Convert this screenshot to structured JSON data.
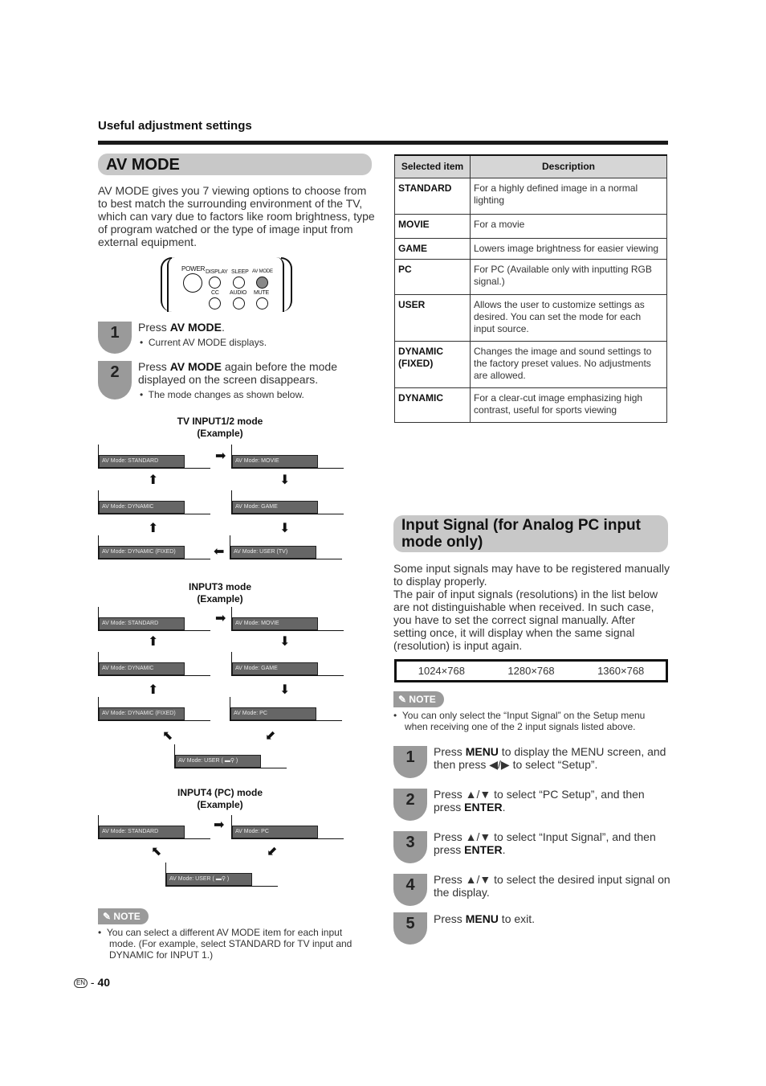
{
  "header": {
    "section_title": "Useful adjustment settings"
  },
  "av_mode": {
    "heading": "AV MODE",
    "intro": "AV MODE gives you 7 viewing options to choose from to best match the surrounding environment of the TV, which can vary due to factors like room brightness, type of program watched or the type of image input from external equipment.",
    "remote": {
      "buttons": [
        "POWER",
        "DISPLAY",
        "SLEEP",
        "AV MODE",
        "CC",
        "AUDIO",
        "MUTE"
      ],
      "highlighted": "AV MODE"
    },
    "steps": [
      {
        "num": "1",
        "pre": "Press ",
        "bold": "AV MODE",
        "post": ".",
        "sub": "Current AV MODE displays."
      },
      {
        "num": "2",
        "pre": "Press ",
        "bold": "AV MODE",
        "post": " again before the mode displayed on the screen disappears.",
        "sub": "The mode changes as shown below."
      }
    ],
    "diagrams": [
      {
        "title_line1": "TV INPUT1/2 mode",
        "title_line2": "(Example)",
        "screens": [
          "AV Mode: STANDARD",
          "AV Mode: MOVIE",
          "AV Mode: DYNAMIC",
          "AV Mode: GAME",
          "AV Mode: DYNAMIC (FIXED)",
          "AV Mode: USER (TV)"
        ]
      },
      {
        "title_line1": "INPUT3 mode",
        "title_line2": "(Example)",
        "screens": [
          "AV Mode: STANDARD",
          "AV Mode: MOVIE",
          "AV Mode: DYNAMIC",
          "AV Mode: GAME",
          "AV Mode: DYNAMIC (FIXED)",
          "AV Mode: PC",
          "AV Mode: USER ( ▬⚲ )"
        ]
      },
      {
        "title_line1": "INPUT4 (PC) mode",
        "title_line2": "(Example)",
        "screens": [
          "AV Mode: STANDARD",
          "AV Mode: PC",
          "AV Mode: USER ( ▬⚲ )"
        ]
      }
    ],
    "note_label": "NOTE",
    "note": "You can select a different AV MODE item for each input mode. (For example, select STANDARD for TV input and DYNAMIC for INPUT 1.)"
  },
  "table": {
    "headers": [
      "Selected item",
      "Description"
    ],
    "rows": [
      {
        "item": "STANDARD",
        "desc": "For a highly defined image in a normal lighting"
      },
      {
        "item": "MOVIE",
        "desc": "For a movie"
      },
      {
        "item": "GAME",
        "desc": "Lowers image brightness for easier viewing"
      },
      {
        "item": "PC",
        "desc": "For PC (Available only with inputting RGB signal.)"
      },
      {
        "item": "USER",
        "desc": "Allows the user to customize settings as desired. You can set the mode for each input source."
      },
      {
        "item": "DYNAMIC (FIXED)",
        "desc": "Changes the image and sound settings to the factory preset values. No adjustments are allowed."
      },
      {
        "item": "DYNAMIC",
        "desc": "For a clear-cut image emphasizing high contrast, useful for sports viewing"
      }
    ]
  },
  "input_signal": {
    "heading": "Input Signal (for Analog PC input mode only)",
    "intro1": "Some input signals may have to be registered manually to display properly.",
    "intro2": "The pair of input signals (resolutions) in the list below are not distinguishable when received. In such case, you have to set the correct signal manually. After setting once, it will display when the same signal (resolution) is input again.",
    "resolutions": [
      "1024×768",
      "1280×768",
      "1360×768"
    ],
    "note_label": "NOTE",
    "note": "You can only select the “Input Signal” on the Setup menu when receiving one of the 2 input signals listed above.",
    "steps": [
      {
        "num": "1",
        "pre": "Press ",
        "bold": "MENU",
        "post": " to display the MENU screen, and then press ◀/▶ to select “Setup”."
      },
      {
        "num": "2",
        "pre": "Press ▲/▼ to select “PC Setup”, and then press ",
        "bold": "ENTER",
        "post": "."
      },
      {
        "num": "3",
        "pre": "Press ▲/▼ to select “Input Signal”, and then press ",
        "bold": "ENTER",
        "post": "."
      },
      {
        "num": "4",
        "pre": "Press ▲/▼ to select the desired input signal on the display.",
        "bold": "",
        "post": ""
      },
      {
        "num": "5",
        "pre": "Press ",
        "bold": "MENU",
        "post": " to exit."
      }
    ]
  },
  "footer": {
    "lang_badge": "EN",
    "separator": "-",
    "page_number": "40"
  }
}
